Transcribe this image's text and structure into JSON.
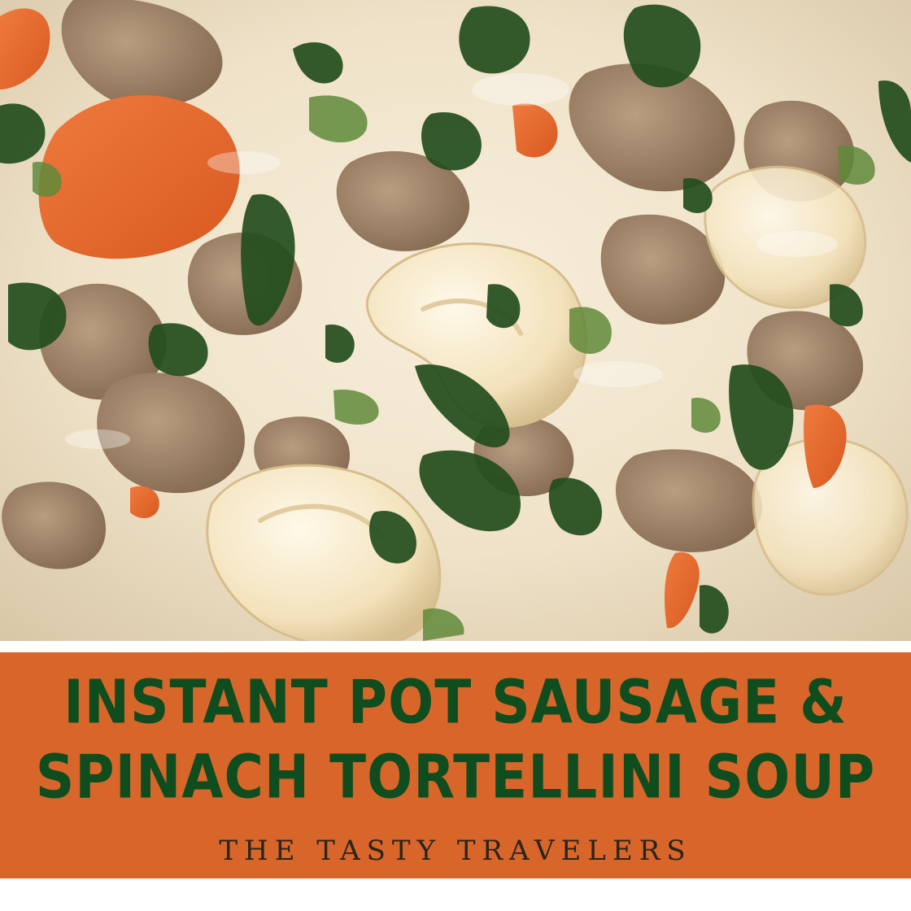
{
  "image": {
    "subject": "creamy soup with tortellini, spinach, sausage and carrots"
  },
  "banner": {
    "title_line1": "INSTANT POT SAUSAGE &",
    "title_line2": "SPINACH TORTELLINI SOUP",
    "brand": "THE TASTY TRAVELERS",
    "background_color": "#d8662a",
    "title_color": "#0f4d1f"
  }
}
